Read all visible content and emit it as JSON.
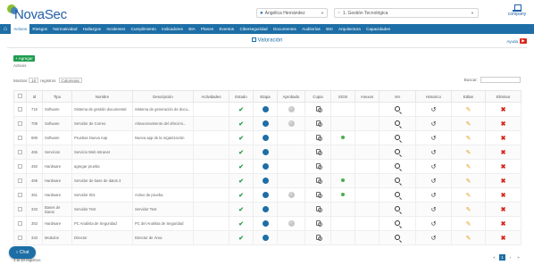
{
  "app": {
    "name": "NovaSec"
  },
  "header": {
    "user_select": {
      "value": "Angélica Hernández"
    },
    "company_select": {
      "value": "1. Gestión Tecnológica"
    },
    "company_logo_text": "company"
  },
  "nav": {
    "items": [
      {
        "label": "Activos",
        "active": true
      },
      {
        "label": "Riesgos"
      },
      {
        "label": "Normatividad"
      },
      {
        "label": "Hallazgos"
      },
      {
        "label": "Incidentes"
      },
      {
        "label": "Cumplimiento"
      },
      {
        "label": "Indicadores"
      },
      {
        "label": "BIA"
      },
      {
        "label": "Planes"
      },
      {
        "label": "Eventos"
      },
      {
        "label": "Ciberseguridad"
      },
      {
        "label": "Documentos"
      },
      {
        "label": "Auditorías"
      },
      {
        "label": "BSI"
      },
      {
        "label": "Arquitectura"
      },
      {
        "label": "Capacidades"
      }
    ]
  },
  "page": {
    "title": "Valoración",
    "help_label": "Ayuda",
    "add_button": "+ Agregar",
    "subtitle": "Activos",
    "show_label": "Mostrar",
    "show_value": "10",
    "show_suffix": "registros",
    "columns_button": "Columnas",
    "search_label": "Buscar:"
  },
  "table": {
    "headers": [
      "",
      "Id",
      "Tipo",
      "Nombre",
      "Descripción",
      "Actividades",
      "Estado",
      "Etapa",
      "Aprobado",
      "Copia",
      "SGSI",
      "Anexos",
      "Ver",
      "Historico",
      "Editar",
      "Eliminar"
    ],
    "rows": [
      {
        "id": "715",
        "tipo": "Software",
        "nombre": "Sistema de gestión documental",
        "desc": "Sistema de generación de docu...",
        "appr": true,
        "sgsi": false
      },
      {
        "id": "708",
        "tipo": "Software",
        "nombre": "Servidor de Correo",
        "desc": "Almacenamiento del ofrecimi...",
        "appr": true,
        "sgsi": false
      },
      {
        "id": "689",
        "tipo": "Software",
        "nombre": "Pruebas Nueva Aap",
        "desc": "Nueva app de la organización",
        "appr": false,
        "sgsi": true
      },
      {
        "id": "465",
        "tipo": "Servicios",
        "nombre": "Servicio Web Intranet",
        "desc": "",
        "appr": false,
        "sgsi": false
      },
      {
        "id": "450",
        "tipo": "Hardware",
        "nombre": "agregar prueba",
        "desc": "",
        "appr": false,
        "sgsi": false
      },
      {
        "id": "469",
        "tipo": "Hardware",
        "nombre": "Servidor de base de datos 3",
        "desc": "",
        "appr": false,
        "sgsi": true
      },
      {
        "id": "361",
        "tipo": "Hardware",
        "nombre": "Servidor 001",
        "desc": "Activo de prueba",
        "appr": true,
        "sgsi": true
      },
      {
        "id": "333",
        "tipo": "Bases de Datos",
        "nombre": "Servidor Test",
        "desc": "Servidor Test",
        "appr": false,
        "sgsi": false
      },
      {
        "id": "353",
        "tipo": "Hardware",
        "nombre": "PC Analista de Seguridad",
        "desc": "PC del Analista de Seguridad",
        "appr": true,
        "sgsi": false
      },
      {
        "id": "333",
        "tipo": "Modulos",
        "nombre": "Director",
        "desc": "Director de Área",
        "appr": false,
        "sgsi": false
      }
    ]
  },
  "footer": {
    "info": "1 al 10 registros",
    "pages": [
      "«",
      "1",
      "›",
      "»"
    ]
  },
  "chat": {
    "label": "Chat"
  }
}
